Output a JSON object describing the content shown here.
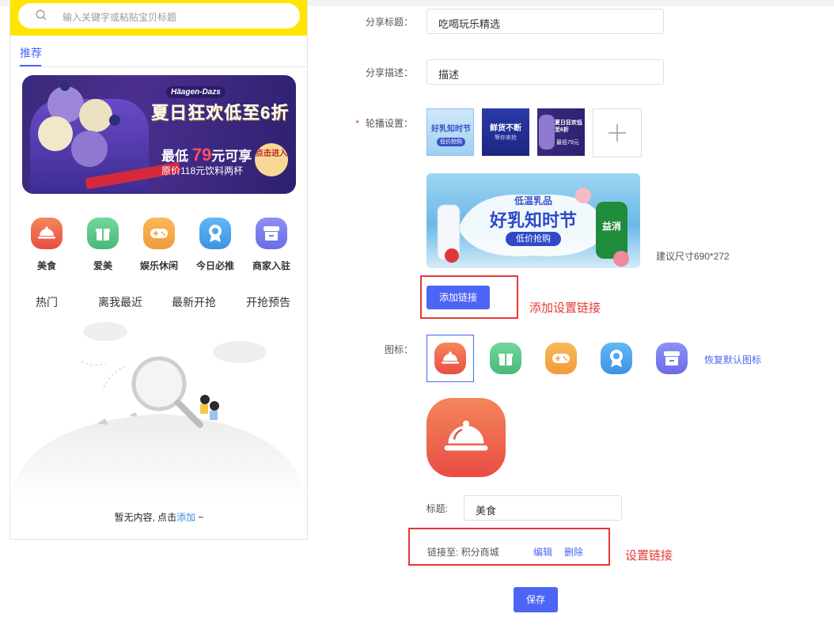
{
  "preview": {
    "search_placeholder": "输入关键字或粘贴宝贝标题",
    "tab_recommend": "推荐",
    "banner": {
      "brand": "Häagen-Dazs",
      "headline": "夏日狂欢低至6折",
      "price_line_prefix": "最低",
      "price_value": "79",
      "price_line_suffix": "元可享",
      "sub_line": "原价118元饮料两杯",
      "stamp": "点击进入"
    },
    "categories": [
      {
        "label": "美食",
        "color": "#f06446",
        "icon": "food-cloche-icon"
      },
      {
        "label": "爱美",
        "color": "#5cc98a",
        "icon": "gift-icon"
      },
      {
        "label": "娱乐休闲",
        "color": "#f7a84a",
        "icon": "gamepad-icon"
      },
      {
        "label": "今日必推",
        "color": "#4ea7f0",
        "icon": "award-icon"
      },
      {
        "label": "商家入驻",
        "color": "#7b7ef0",
        "icon": "store-icon"
      }
    ],
    "sub_tabs": [
      "热门",
      "离我最近",
      "最新开抢",
      "开抢预告"
    ],
    "empty_text_prefix": "暂无内容, 点击",
    "empty_text_link": "添加",
    "empty_text_suffix": " ~"
  },
  "form": {
    "share_title_label": "分享标题：",
    "share_title_value": "吃喝玩乐精选",
    "share_desc_label": "分享描述：",
    "share_desc_value": "描述",
    "carousel_required": "*",
    "carousel_label": "轮播设置：",
    "carousel_thumbs": [
      {
        "caption": "好乳知时节",
        "sub": "低价抢购"
      },
      {
        "caption": "鲜货不断",
        "sub": "等你来抢"
      },
      {
        "caption": "夏日狂欢低至6折",
        "sub": "最低79元"
      }
    ],
    "preview_banner": {
      "top": "低温乳品",
      "main": "好乳知时节",
      "pill": "低价抢购",
      "bottle": "益消"
    },
    "size_hint": "建议尺寸690*272",
    "add_link_button": "添加链接",
    "annotation_add_link": "添加设置链接",
    "icon_label": "图标：",
    "icon_options": [
      {
        "icon": "food-cloche-icon",
        "color": "#f06446",
        "selected": true
      },
      {
        "icon": "gift-icon",
        "color": "#5cc98a",
        "selected": false
      },
      {
        "icon": "gamepad-icon",
        "color": "#f7a84a",
        "selected": false
      },
      {
        "icon": "award-icon",
        "color": "#4ea7f0",
        "selected": false
      },
      {
        "icon": "store-icon",
        "color": "#7b7ef0",
        "selected": false
      }
    ],
    "reset_icon_link": "恢复默认图标",
    "title_label": "标题:",
    "title_value": "美食",
    "link_to_label": "链接至: 积分商城",
    "edit_link": "编辑",
    "delete_link": "删除",
    "annotation_set_link": "设置链接",
    "save_button": "保存",
    "accent_color": "#4c65f5",
    "annotation_color": "#e53935"
  }
}
